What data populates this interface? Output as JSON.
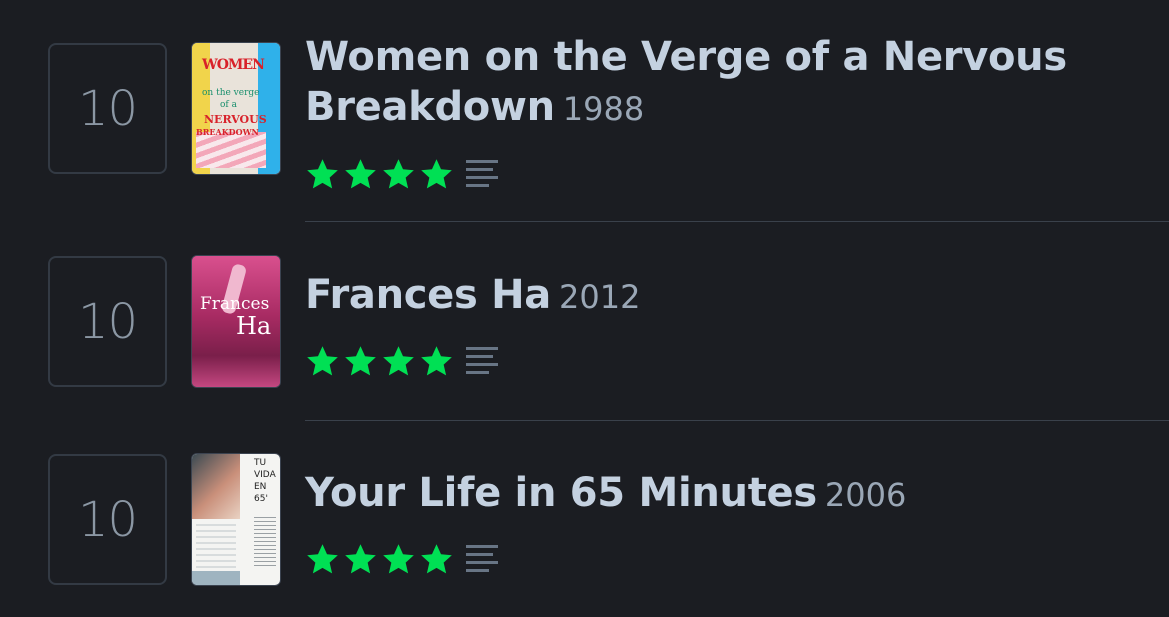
{
  "films": [
    {
      "rank": "10",
      "title": "Women on the Verge of a Nervous Breakdown",
      "year": "1988",
      "stars": 4,
      "poster": {
        "lines": [
          "WOMEN",
          "on the verge",
          "of a",
          "NERVOUS",
          "BREAKDOWN"
        ]
      }
    },
    {
      "rank": "10",
      "title": "Frances Ha",
      "year": "2012",
      "stars": 4,
      "poster": {
        "lines": [
          "Frances",
          "Ha"
        ]
      }
    },
    {
      "rank": "10",
      "title": "Your Life in 65 Minutes",
      "year": "2006",
      "stars": 4,
      "poster": {
        "lines": [
          "TU",
          "VIDA",
          "EN",
          "65'"
        ]
      }
    }
  ],
  "colors": {
    "star": "#00e054",
    "background": "#1b1d22",
    "title": "#c4d1e0"
  }
}
